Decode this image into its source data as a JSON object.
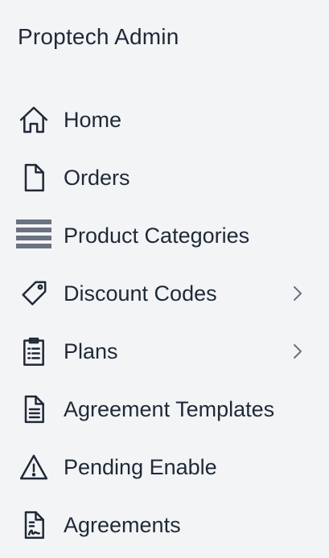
{
  "app": {
    "title": "Proptech Admin"
  },
  "nav": {
    "items": [
      {
        "label": "Home",
        "icon": "home-icon"
      },
      {
        "label": "Orders",
        "icon": "document-icon"
      },
      {
        "label": "Product Categories",
        "icon": "list-lines-icon"
      },
      {
        "label": "Discount Codes",
        "icon": "tag-icon",
        "expandable": true
      },
      {
        "label": "Plans",
        "icon": "clipboard-icon",
        "expandable": true
      },
      {
        "label": "Agreement Templates",
        "icon": "document-text-icon"
      },
      {
        "label": "Pending Enable",
        "icon": "warning-icon"
      },
      {
        "label": "Agreements",
        "icon": "signed-document-icon"
      }
    ]
  },
  "colors": {
    "background": "#f3f4f6",
    "text": "#1f2937",
    "icon": "#1f2937",
    "muted_icon": "#6b7280"
  }
}
